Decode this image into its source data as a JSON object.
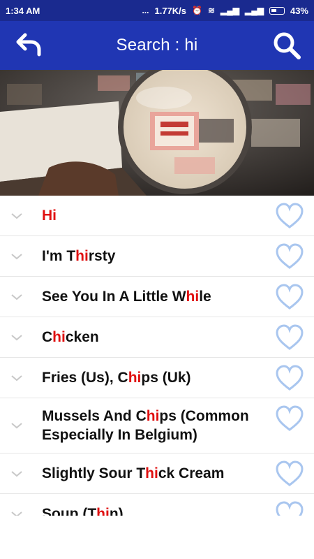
{
  "status": {
    "time": "1:34 AM",
    "dots": "...",
    "speed": "1.77K/s",
    "battery": "43%"
  },
  "header": {
    "title": "Search : hi",
    "back_icon": "back-arrow-icon",
    "search_icon": "search-icon",
    "background": "#2036b3"
  },
  "results": [
    {
      "parts": [
        "",
        "Hi",
        ""
      ],
      "whole_red": true
    },
    {
      "parts": [
        "I'm T",
        "hi",
        "rsty"
      ]
    },
    {
      "parts": [
        "See You In A Little W",
        "hi",
        "le"
      ]
    },
    {
      "parts": [
        "C",
        "hi",
        "cken"
      ]
    },
    {
      "parts": [
        "Fries (Us), C",
        "hi",
        "ps (Uk)"
      ]
    },
    {
      "parts": [
        "Mussels And C",
        "hi",
        "ps (Common Especially In Belgium)"
      ]
    },
    {
      "parts": [
        "Slightly Sour T",
        "hi",
        "ck Cream"
      ]
    },
    {
      "parts": [
        "Soup (T",
        "hi",
        "n)"
      ]
    }
  ],
  "colors": {
    "highlight": "#e01010",
    "heart": "#a9c6ef"
  }
}
